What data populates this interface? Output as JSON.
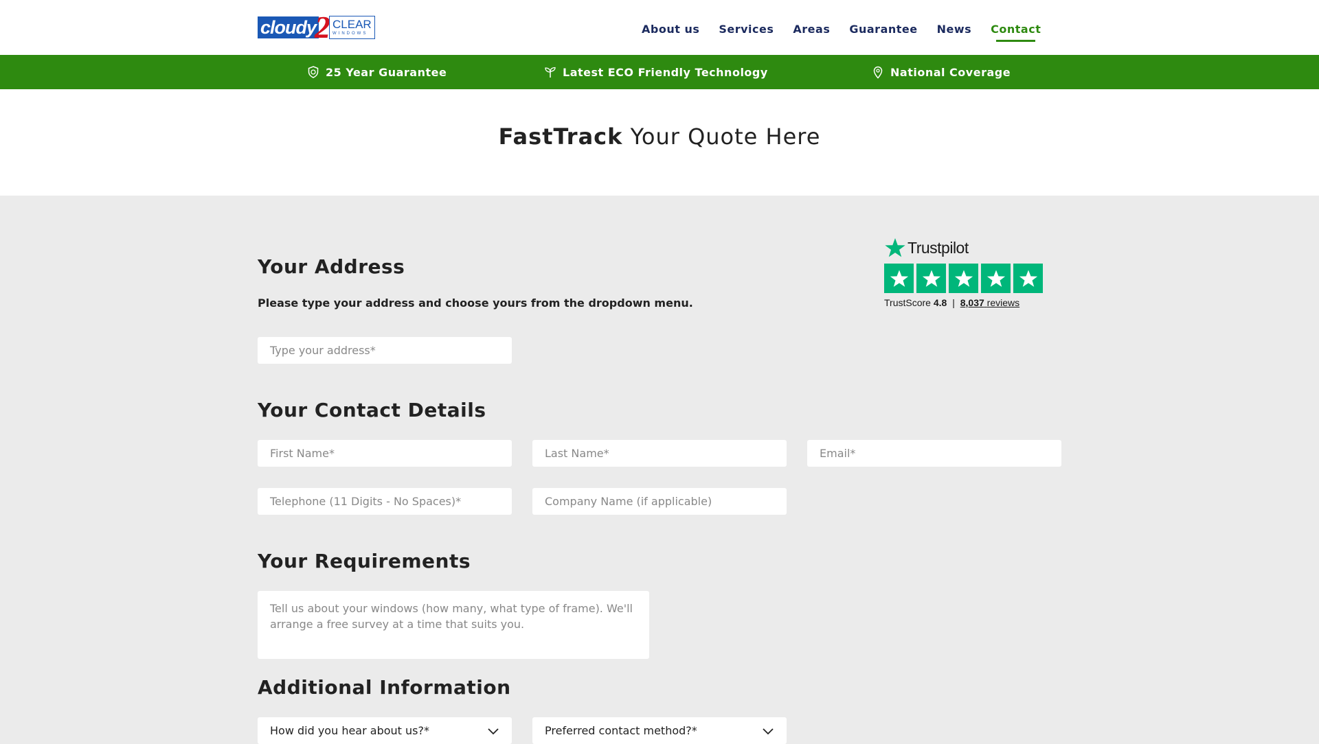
{
  "header": {
    "logo": {
      "part1": "cloudy",
      "part2": "2",
      "part3": "CLEAR",
      "part4": "WINDOWS"
    },
    "nav": [
      {
        "label": "About us"
      },
      {
        "label": "Services"
      },
      {
        "label": "Areas"
      },
      {
        "label": "Guarantee"
      },
      {
        "label": "News"
      },
      {
        "label": "Contact"
      }
    ],
    "active_nav": "Contact"
  },
  "benefits_bar": {
    "items": [
      {
        "icon": "shield-icon",
        "label": "25 Year Guarantee"
      },
      {
        "icon": "leaf-sprout-icon",
        "label": "Latest ECO Friendly Technology"
      },
      {
        "icon": "map-pin-icon",
        "label": "National Coverage"
      }
    ]
  },
  "hero": {
    "title_bold": "FastTrack",
    "title_rest": " Your Quote Here"
  },
  "address_section": {
    "title": "Your Address",
    "hint": "Please type your address and choose yours from the dropdown menu.",
    "address_placeholder": "Type your address*"
  },
  "contact_section": {
    "title": "Your Contact Details",
    "first_name_placeholder": "First Name*",
    "last_name_placeholder": "Last Name*",
    "email_placeholder": "Email*",
    "telephone_placeholder": "Telephone (11 Digits - No Spaces)*",
    "company_placeholder": "Company Name (if applicable)"
  },
  "requirements_section": {
    "title": "Your Requirements",
    "placeholder": "Tell us about your windows (how many, what type of frame). We'll arrange a free survey at a time that suits you."
  },
  "additional_section": {
    "title": "Additional Information",
    "hear_about_selected": "How did you hear about us?*",
    "contact_method_selected": "Preferred contact method?*"
  },
  "trustpilot": {
    "brand": "Trustpilot",
    "trustscore_label": "TrustScore",
    "trustscore_value": "4.8",
    "separator": "|",
    "reviews_count": "8,037",
    "reviews_label": "reviews",
    "stars": 5
  },
  "colors": {
    "green_bar": "#2e8a10",
    "nav_text": "#1b2a5e",
    "nav_active": "#2e8a10",
    "trustpilot_green": "#00b67a",
    "page_bg": "#ebebeb"
  }
}
